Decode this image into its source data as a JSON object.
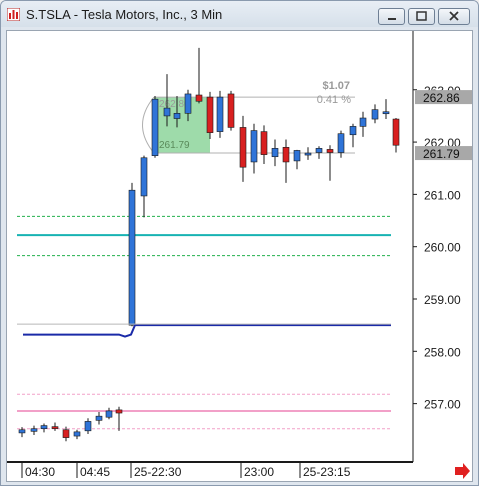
{
  "window": {
    "title": "S.TSLA - Tesla Motors, Inc., 3 Min",
    "buttons": [
      "minimize",
      "maximize",
      "close"
    ]
  },
  "chart_data": {
    "type": "candlestick",
    "symbol": "S.TSLA",
    "interval": "3 Min",
    "ylim": [
      256.4,
      263.55
    ],
    "y_ticks": [
      "263.00",
      "262.00",
      "261.00",
      "260.00",
      "259.00",
      "258.00",
      "257.00"
    ],
    "x_ticks": [
      "04:30",
      "04:45",
      "25-22:30",
      "23:00",
      "25-23:15"
    ],
    "price_tags": [
      {
        "value": "262.86",
        "color": "#a8a8a8"
      },
      {
        "value": "261.79",
        "color": "#a8a8a8"
      }
    ],
    "measure": {
      "change": "$1.07",
      "percent": "0.41 %",
      "top_label": "262.86",
      "bottom_label": "261.79"
    },
    "levels": [
      {
        "y": 260.58,
        "color": "#22b14c",
        "style": "dashed"
      },
      {
        "y": 260.22,
        "color": "#17b3b3",
        "style": "solid"
      },
      {
        "y": 259.83,
        "color": "#22b14c",
        "style": "dashed"
      },
      {
        "y": 257.18,
        "color": "#f2a0c8",
        "style": "dashed"
      },
      {
        "y": 256.86,
        "color": "#f2a0c8",
        "style": "solid"
      },
      {
        "y": 256.52,
        "color": "#f2a0c8",
        "style": "dashed"
      }
    ],
    "candles": [
      {
        "o": 256.44,
        "h": 256.55,
        "l": 256.36,
        "c": 256.5
      },
      {
        "o": 256.47,
        "h": 256.58,
        "l": 256.4,
        "c": 256.52
      },
      {
        "o": 256.52,
        "h": 256.62,
        "l": 256.45,
        "c": 256.58
      },
      {
        "o": 256.56,
        "h": 256.64,
        "l": 256.48,
        "c": 256.54
      },
      {
        "o": 256.5,
        "h": 256.56,
        "l": 256.28,
        "c": 256.35
      },
      {
        "o": 256.38,
        "h": 256.5,
        "l": 256.32,
        "c": 256.46
      },
      {
        "o": 256.48,
        "h": 256.72,
        "l": 256.42,
        "c": 256.66
      },
      {
        "o": 256.68,
        "h": 256.84,
        "l": 256.6,
        "c": 256.76
      },
      {
        "o": 256.74,
        "h": 256.92,
        "l": 256.7,
        "c": 256.86
      },
      {
        "o": 256.88,
        "h": 256.94,
        "l": 256.48,
        "c": 256.82
      },
      {
        "o": 258.5,
        "h": 261.22,
        "l": 258.48,
        "c": 261.08
      },
      {
        "o": 260.97,
        "h": 261.74,
        "l": 260.56,
        "c": 261.7
      },
      {
        "o": 261.74,
        "h": 262.88,
        "l": 261.7,
        "c": 262.82
      },
      {
        "o": 262.5,
        "h": 263.3,
        "l": 262.3,
        "c": 262.65
      },
      {
        "o": 262.45,
        "h": 262.88,
        "l": 262.28,
        "c": 262.55
      },
      {
        "o": 262.55,
        "h": 263.0,
        "l": 262.4,
        "c": 262.92
      },
      {
        "o": 262.9,
        "h": 263.8,
        "l": 262.74,
        "c": 262.78
      },
      {
        "o": 262.86,
        "h": 262.96,
        "l": 262.06,
        "c": 262.18
      },
      {
        "o": 262.2,
        "h": 262.98,
        "l": 262.08,
        "c": 262.86
      },
      {
        "o": 262.92,
        "h": 262.98,
        "l": 262.22,
        "c": 262.28
      },
      {
        "o": 262.28,
        "h": 262.5,
        "l": 261.24,
        "c": 261.52
      },
      {
        "o": 261.62,
        "h": 262.35,
        "l": 261.4,
        "c": 262.22
      },
      {
        "o": 262.2,
        "h": 262.32,
        "l": 261.58,
        "c": 261.76
      },
      {
        "o": 261.72,
        "h": 262.05,
        "l": 261.54,
        "c": 261.88
      },
      {
        "o": 261.9,
        "h": 262.05,
        "l": 261.22,
        "c": 261.62
      },
      {
        "o": 261.64,
        "h": 261.85,
        "l": 261.48,
        "c": 261.84
      },
      {
        "o": 261.79,
        "h": 261.9,
        "l": 261.66,
        "c": 261.79
      },
      {
        "o": 261.8,
        "h": 261.92,
        "l": 261.68,
        "c": 261.88
      },
      {
        "o": 261.86,
        "h": 261.94,
        "l": 261.26,
        "c": 261.8
      },
      {
        "o": 261.8,
        "h": 262.22,
        "l": 261.7,
        "c": 262.16
      },
      {
        "o": 262.14,
        "h": 262.35,
        "l": 261.9,
        "c": 262.3
      },
      {
        "o": 262.3,
        "h": 262.58,
        "l": 262.1,
        "c": 262.46
      },
      {
        "o": 262.44,
        "h": 262.72,
        "l": 262.36,
        "c": 262.62
      },
      {
        "o": 262.56,
        "h": 262.82,
        "l": 262.44,
        "c": 262.58
      },
      {
        "o": 262.44,
        "h": 262.46,
        "l": 261.8,
        "c": 261.94
      }
    ],
    "candle_x": [
      21,
      33,
      43,
      54,
      65,
      76,
      87,
      98,
      108,
      118,
      131,
      143,
      154,
      166,
      176,
      187,
      198,
      209,
      219,
      230,
      242,
      253,
      263,
      274,
      285,
      296,
      307,
      318,
      329,
      340,
      352,
      362,
      374,
      385
    ],
    "colors": {
      "up": "#2f74d8",
      "down": "#d82020",
      "background": "#ffffff",
      "grid_text": "#1a1a1a"
    }
  }
}
